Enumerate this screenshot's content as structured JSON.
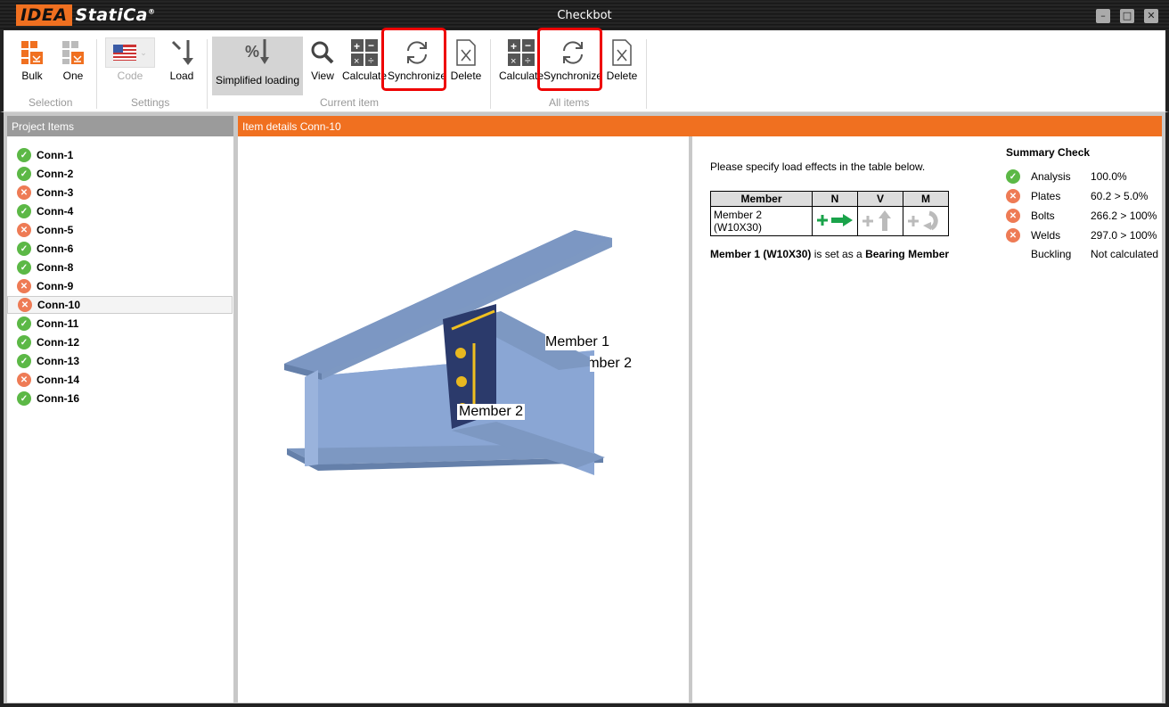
{
  "app": {
    "logo": "IDEA StatiCa",
    "title": "Checkbot"
  },
  "ribbon": {
    "bulk": "Bulk",
    "one": "One",
    "selection": "Selection",
    "code": "Code",
    "load": "Load",
    "settings": "Settings",
    "simplified_loading": "Simplified loading",
    "view": "View",
    "calculate": "Calculate",
    "synchronize": "Synchronize",
    "delete": "Delete",
    "current_item": "Current item",
    "calculate_all": "Calculate",
    "synchronize_all": "Synchronize",
    "delete_all": "Delete",
    "all_items": "All items"
  },
  "left": {
    "header": "Project Items",
    "items": [
      {
        "label": "Conn-1",
        "status": "ok"
      },
      {
        "label": "Conn-2",
        "status": "ok"
      },
      {
        "label": "Conn-3",
        "status": "fail"
      },
      {
        "label": "Conn-4",
        "status": "ok"
      },
      {
        "label": "Conn-5",
        "status": "fail"
      },
      {
        "label": "Conn-6",
        "status": "ok"
      },
      {
        "label": "Conn-8",
        "status": "ok"
      },
      {
        "label": "Conn-9",
        "status": "fail"
      },
      {
        "label": "Conn-10",
        "status": "fail"
      },
      {
        "label": "Conn-11",
        "status": "ok"
      },
      {
        "label": "Conn-12",
        "status": "ok"
      },
      {
        "label": "Conn-13",
        "status": "ok"
      },
      {
        "label": "Conn-14",
        "status": "fail"
      },
      {
        "label": "Conn-16",
        "status": "ok"
      }
    ],
    "selected": "Conn-10"
  },
  "main": {
    "header": "Item details  Conn-10",
    "view_labels": {
      "m1": "Member 1",
      "m2a": "Member 2",
      "m2b": "Member 2"
    },
    "instruction": "Please specify load effects in the table below.",
    "table": {
      "headers": [
        "Member",
        "N",
        "V",
        "M"
      ],
      "row": "Member 2 (W10X30)"
    },
    "bearing": {
      "b1": "Member 1 (W10X30)",
      "mid": " is set as a ",
      "b2": "Bearing Member"
    },
    "summary": {
      "title": "Summary Check",
      "rows": [
        {
          "label": "Analysis",
          "value": "100.0%",
          "status": "ok"
        },
        {
          "label": "Plates",
          "value": "60.2 >  5.0%",
          "status": "fail"
        },
        {
          "label": "Bolts",
          "value": "266.2 > 100%",
          "status": "fail"
        },
        {
          "label": "Welds",
          "value": "297.0 > 100%",
          "status": "fail"
        },
        {
          "label": "Buckling",
          "value": "Not calculated",
          "status": "none"
        }
      ]
    }
  },
  "colors": {
    "accent": "#f07020",
    "ok": "#5cb846",
    "fail": "#ee7b55",
    "highlight": "#e00000"
  }
}
